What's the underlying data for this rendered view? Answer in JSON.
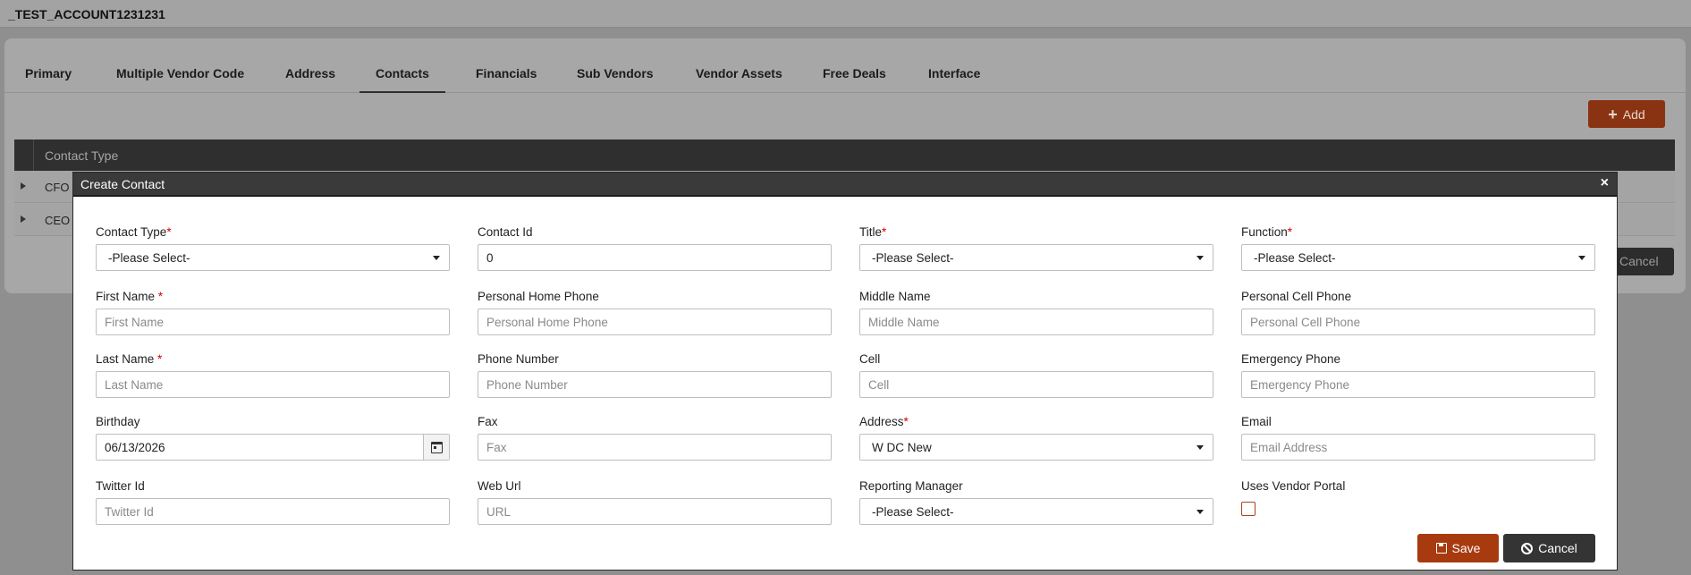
{
  "account": {
    "name": "_TEST_ACCOUNT1231231"
  },
  "tabs": [
    {
      "label": "Primary"
    },
    {
      "label": "Multiple Vendor Code"
    },
    {
      "label": "Address"
    },
    {
      "label": "Contacts",
      "active": true
    },
    {
      "label": "Financials"
    },
    {
      "label": "Sub Vendors"
    },
    {
      "label": "Vendor Assets"
    },
    {
      "label": "Free Deals"
    },
    {
      "label": "Interface"
    }
  ],
  "toolbar": {
    "add_label": "Add"
  },
  "grid": {
    "columns": [
      "Contact Type"
    ],
    "rows": [
      {
        "contact_type": "CFO"
      },
      {
        "contact_type": "CEO"
      }
    ]
  },
  "background": {
    "cancel_label": "Cancel"
  },
  "modal": {
    "title": "Create Contact",
    "close_glyph": "×",
    "fields": {
      "contact_type": {
        "label": "Contact Type",
        "required_mark": "*",
        "value": "-Please Select-"
      },
      "contact_id": {
        "label": "Contact Id",
        "value": "0"
      },
      "title": {
        "label": "Title",
        "required_mark": "*",
        "value": "-Please Select-"
      },
      "function": {
        "label": "Function",
        "required_mark": "*",
        "value": "-Please Select-"
      },
      "first_name": {
        "label": "First Name ",
        "required_mark": "*",
        "placeholder": "First Name"
      },
      "personal_home_phone": {
        "label": "Personal Home Phone",
        "placeholder": "Personal Home Phone"
      },
      "middle_name": {
        "label": "Middle Name",
        "placeholder": "Middle Name"
      },
      "personal_cell_phone": {
        "label": "Personal Cell Phone",
        "placeholder": "Personal Cell Phone"
      },
      "last_name": {
        "label": "Last Name ",
        "required_mark": "*",
        "placeholder": "Last Name"
      },
      "phone_number": {
        "label": "Phone Number",
        "placeholder": "Phone Number"
      },
      "cell": {
        "label": "Cell",
        "placeholder": "Cell"
      },
      "emergency_phone": {
        "label": "Emergency Phone",
        "placeholder": "Emergency Phone"
      },
      "birthday": {
        "label": "Birthday",
        "value": "06/13/2026"
      },
      "fax": {
        "label": "Fax",
        "placeholder": "Fax"
      },
      "address": {
        "label": "Address",
        "required_mark": "*",
        "value": "W DC New"
      },
      "email": {
        "label": "Email",
        "placeholder": "Email Address"
      },
      "twitter_id": {
        "label": "Twitter Id",
        "placeholder": "Twitter Id"
      },
      "web_url": {
        "label": "Web Url",
        "placeholder": "URL"
      },
      "reporting_manager": {
        "label": "Reporting Manager",
        "value": "-Please Select-"
      },
      "uses_vendor_portal": {
        "label": "Uses Vendor Portal",
        "checked": false
      }
    },
    "save_label": "Save",
    "cancel_label": "Cancel"
  },
  "icons": {
    "add": "plus-icon",
    "close": "close-icon",
    "calendar": "calendar-icon",
    "save": "floppy-disk-icon",
    "cancel": "ban-icon",
    "dropdown": "chevron-down-icon",
    "expand": "expand-arrow-icon"
  },
  "colors": {
    "primary": "#a83a10",
    "dark": "#343434",
    "required": "#d40000"
  }
}
